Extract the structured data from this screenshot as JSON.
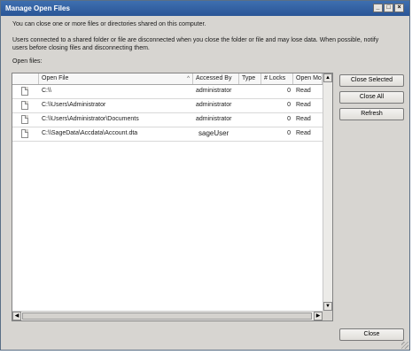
{
  "window": {
    "title": "Manage Open Files",
    "controls": {
      "minimize": "_",
      "maximize": "□",
      "close": "×"
    }
  },
  "intro_text": "You can close one or more files or directories shared on this computer.",
  "warning_text": "Users connected to a shared folder or file are disconnected when you close the folder or file and may lose data. When possible, notify users before closing files and disconnecting them.",
  "list_label": "Open files:",
  "table": {
    "columns": [
      "Open File",
      "Accessed By",
      "Type",
      "# Locks",
      "Open Mode"
    ],
    "sort_indicator": "^",
    "rows": [
      {
        "open_file": "C:\\\\",
        "accessed_by": "administrator",
        "type": "",
        "locks": "0",
        "open_mode": "Read"
      },
      {
        "open_file": "C:\\\\Users\\Administrator",
        "accessed_by": "administrator",
        "type": "",
        "locks": "0",
        "open_mode": "Read"
      },
      {
        "open_file": "C:\\\\Users\\Administrator\\Documents",
        "accessed_by": "administrator",
        "type": "",
        "locks": "0",
        "open_mode": "Read"
      },
      {
        "open_file": "C:\\\\SageData\\Accdata\\Account.dta",
        "accessed_by": "sageUser",
        "type": "",
        "locks": "0",
        "open_mode": "Read"
      }
    ]
  },
  "scroll": {
    "up": "▲",
    "down": "▼",
    "left": "◀",
    "right": "▶"
  },
  "buttons": {
    "close_selected": "Close Selected",
    "close_all": "Close All",
    "refresh": "Refresh",
    "close": "Close"
  }
}
